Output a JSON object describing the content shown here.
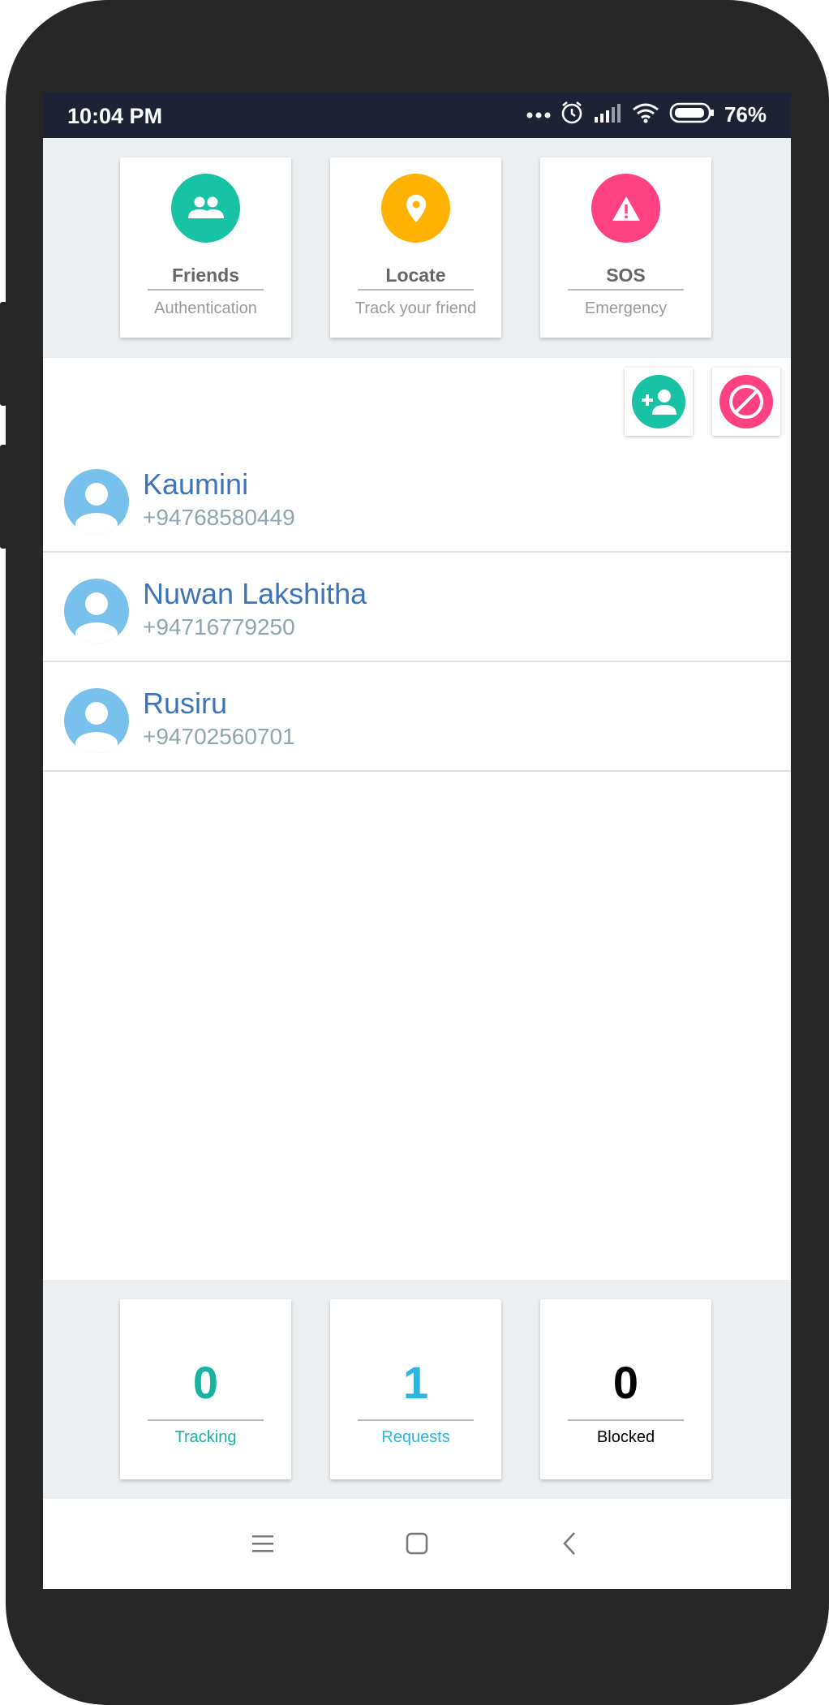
{
  "status": {
    "time": "10:04 PM",
    "battery": "76%",
    "icons": [
      "more-dots-icon",
      "alarm-icon",
      "signal-icon",
      "wifi-icon",
      "battery-icon"
    ]
  },
  "top_cards": [
    {
      "title": "Friends",
      "subtitle": "Authentication",
      "icon": "people-icon",
      "color": "#17c3a4"
    },
    {
      "title": "Locate",
      "subtitle": "Track your friend",
      "icon": "location-pin-icon",
      "color": "#ffb300"
    },
    {
      "title": "SOS",
      "subtitle": "Emergency",
      "icon": "warning-icon",
      "color": "#ff4081"
    }
  ],
  "actions": {
    "add_friend_icon": "add-person-icon",
    "block_icon": "block-icon",
    "add_color": "#17c3a4",
    "block_color": "#ff4081"
  },
  "friends": [
    {
      "name": "Kaumini",
      "phone": "+94768580449"
    },
    {
      "name": "Nuwan Lakshitha",
      "phone": "+94716779250"
    },
    {
      "name": "Rusiru",
      "phone": "+94702560701"
    }
  ],
  "stats": [
    {
      "value": "0",
      "label": "Tracking",
      "color": "#17b39e"
    },
    {
      "value": "1",
      "label": "Requests",
      "color": "#29b6e0"
    },
    {
      "value": "0",
      "label": "Blocked",
      "color": "#000000"
    }
  ],
  "nav": {
    "icons": [
      "menu-icon",
      "home-square-icon",
      "back-icon"
    ]
  }
}
